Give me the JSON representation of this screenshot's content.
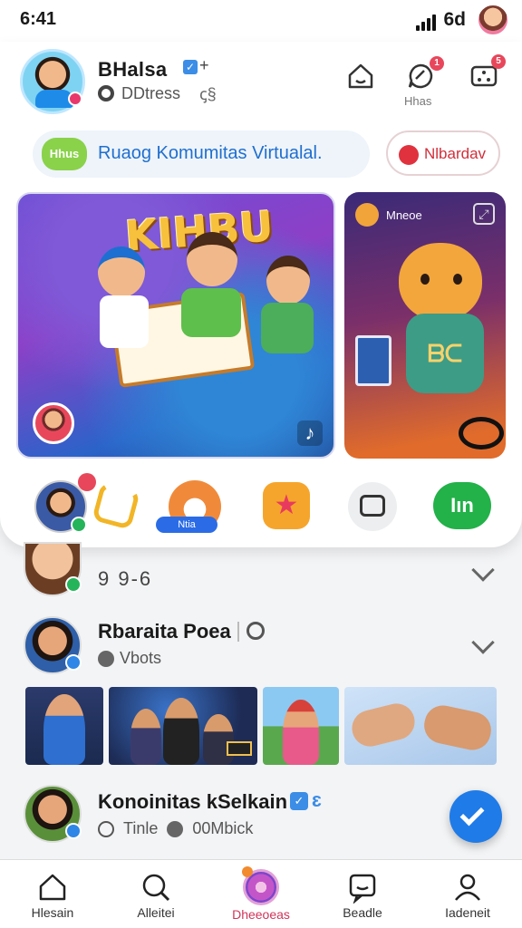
{
  "status_bar": {
    "time": "6:41",
    "network": "6d"
  },
  "profile": {
    "name": "BHalsa",
    "plus": "+",
    "subtitle": "DDtress",
    "sub_glyph": "ꞔ§"
  },
  "header": {
    "messages_label": "Hhas",
    "badge_notifications": "5",
    "badge_messages": "1"
  },
  "community": {
    "chip": "Hhus",
    "text": "Ruaog Komumitas Virtualal.",
    "button": "Nlbardav"
  },
  "cards": {
    "main": {
      "title": "KIHBU"
    },
    "side": {
      "label": "Mneoe"
    }
  },
  "actions": {
    "tag": "Ntia",
    "join": "Iın"
  },
  "feed": [
    {
      "value": "9 9-6"
    },
    {
      "name": "Rbaraita Poea",
      "sub": "Vbots"
    },
    {
      "name": "Konoinitas kSelkain",
      "extra": "ɛ",
      "time": "Tinle",
      "count": "00Mbick"
    }
  ],
  "nav": [
    {
      "label": "Hlesain",
      "icon": "home-icon"
    },
    {
      "label": "Alleitei",
      "icon": "search-icon"
    },
    {
      "label": "Dheeoeas",
      "icon": "discover-icon"
    },
    {
      "label": "Beadle",
      "icon": "messages-icon"
    },
    {
      "label": "Iadeneit",
      "icon": "profile-icon"
    }
  ],
  "colors": {
    "accent": "#1f7be8",
    "brand_red": "#e0323e",
    "green": "#23b149",
    "nav_active": "#d0345a"
  }
}
